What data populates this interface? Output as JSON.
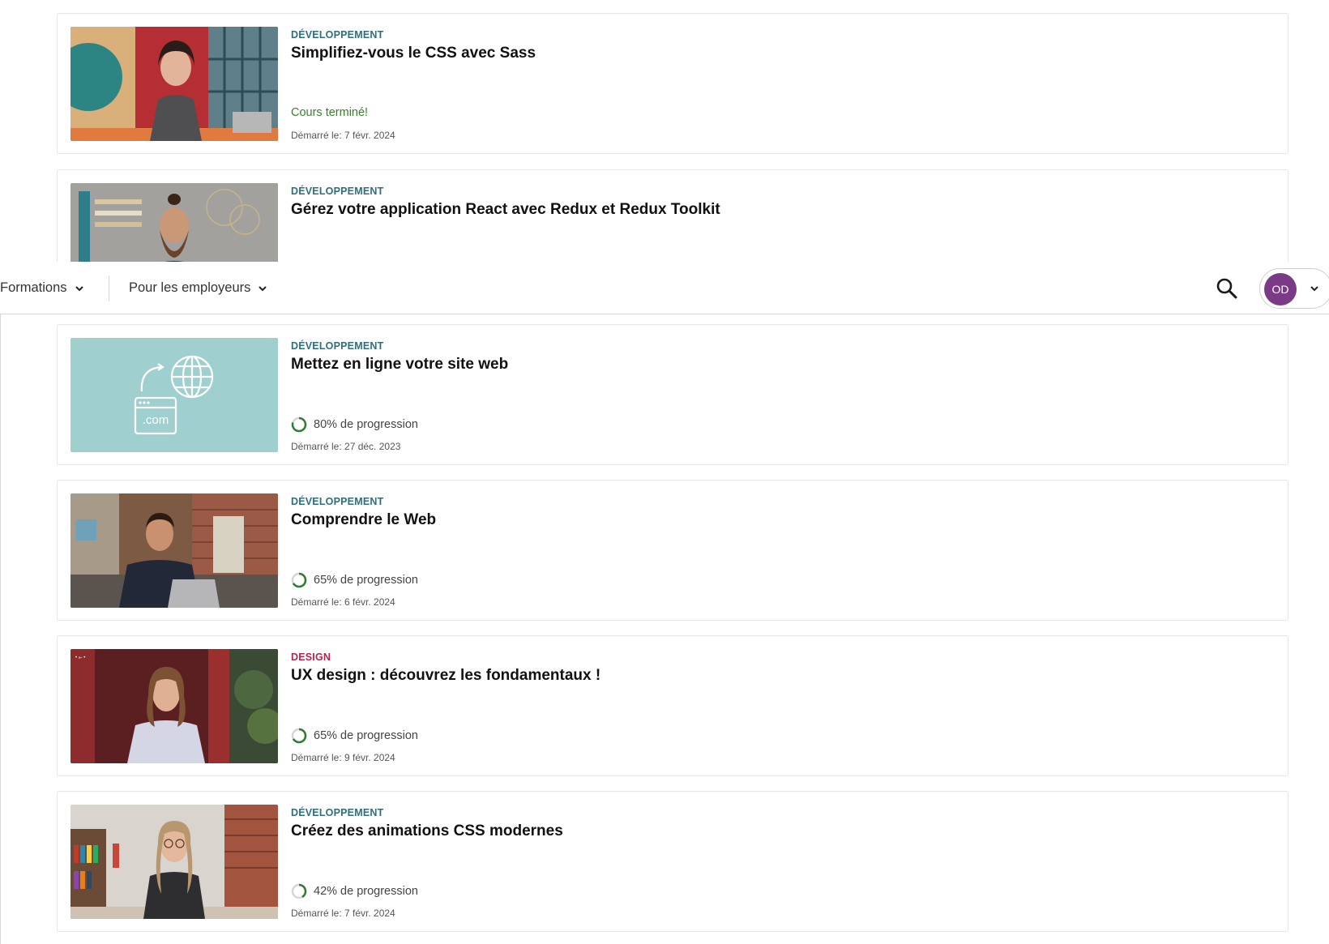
{
  "nav": {
    "formations_label": "Formations",
    "employers_label": "Pour les employeurs",
    "avatar_initials": "OD",
    "accent_color": "#7a3a86"
  },
  "courses": [
    {
      "category": "DÉVELOPPEMENT",
      "title": "Simplifiez-vous le CSS avec Sass",
      "status": "Cours terminé!",
      "started": "Démarré le: 7 févr. 2024",
      "thumbnail": "instructor-woman-orange-room"
    },
    {
      "category": "DÉVELOPPEMENT",
      "title": "Gérez votre application React avec Redux et Redux Toolkit",
      "status": "",
      "started": "",
      "thumbnail": "instructor-bearded-man-grey-wall"
    },
    {
      "category": "DÉVELOPPEMENT",
      "title": "Mettez en ligne votre site web",
      "progress": 0.8,
      "status": "80% de progression",
      "started": "Démarré le: 27 déc. 2023",
      "thumbnail": "globe-dotcom-illustration"
    },
    {
      "category": "DÉVELOPPEMENT",
      "title": "Comprendre le Web",
      "progress": 0.65,
      "status": "65% de progression",
      "started": "Démarré le: 6 févr. 2024",
      "thumbnail": "instructor-man-laptop-brick"
    },
    {
      "category": "DESIGN",
      "title": "UX design : découvrez les fondamentaux !",
      "progress": 0.65,
      "status": "65% de progression",
      "started": "Démarré le: 9 févr. 2024",
      "thumbnail": "instructor-woman-red-background"
    },
    {
      "category": "DÉVELOPPEMENT",
      "title": "Créez des animations CSS modernes",
      "progress": 0.42,
      "status": "42% de progression",
      "started": "Démarré le: 7 févr. 2024",
      "thumbnail": "instructor-woman-bookshelf-brick"
    }
  ]
}
